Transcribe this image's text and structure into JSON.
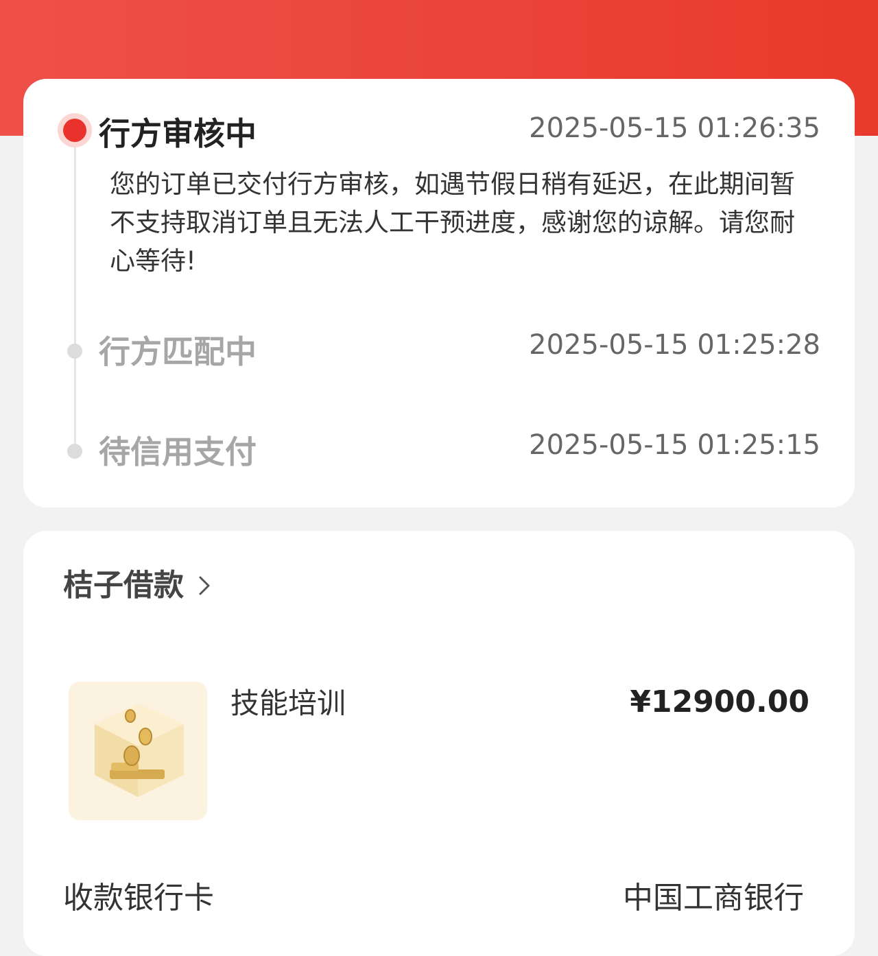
{
  "header": {
    "color": "#e83a2c"
  },
  "timeline": {
    "steps": [
      {
        "title": "行方审核中",
        "time": "2025-05-15 01:26:35",
        "description": "您的订单已交付行方审核，如遇节假日稍有延迟，在此期间暂不支持取消订单且无法人工干预进度，感谢您的谅解。请您耐心等待!",
        "active": true
      },
      {
        "title": "行方匹配中",
        "time": "2025-05-15 01:25:28",
        "active": false
      },
      {
        "title": "待信用支付",
        "time": "2025-05-15 01:25:15",
        "active": false
      }
    ]
  },
  "order": {
    "merchant": "桔子借款",
    "product_name": "技能培训",
    "product_icon": "coin-box-icon",
    "price": "¥12900.00",
    "bank_label": "收款银行卡",
    "bank_value": "中国工商银行"
  },
  "colors": {
    "accent": "#e8322b",
    "inactive_text": "#a6a6a6"
  }
}
